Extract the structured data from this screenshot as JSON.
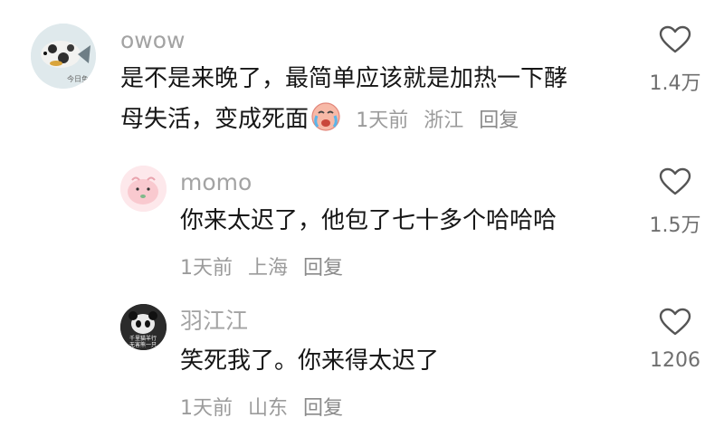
{
  "comments": [
    {
      "username": "owow",
      "avatar_caption": "今日鱼",
      "text_line1": "是不是来晚了，最简单应该就是加热一下酵",
      "text_line2": "母失活，变成死面",
      "emoji": "crying-face-emoji",
      "time": "1天前",
      "location": "浙江",
      "reply_label": "回复",
      "likes": "1.4万"
    },
    {
      "username": "momo",
      "text": "你来太迟了，他包了七十多个哈哈哈",
      "time": "1天前",
      "location": "上海",
      "reply_label": "回复",
      "likes": "1.5万"
    },
    {
      "username": "羽江江",
      "avatar_caption_line1": "千里猫羊行",
      "avatar_caption_line2": "无害熊一只",
      "text": "笑死我了。你来得太迟了",
      "time": "1天前",
      "location": "山东",
      "reply_label": "回复",
      "likes": "1206"
    }
  ],
  "icons": {
    "like": "heart-outline-icon"
  },
  "colors": {
    "text": "#161616",
    "secondary": "#a3a3a3",
    "icon": "#555555"
  }
}
